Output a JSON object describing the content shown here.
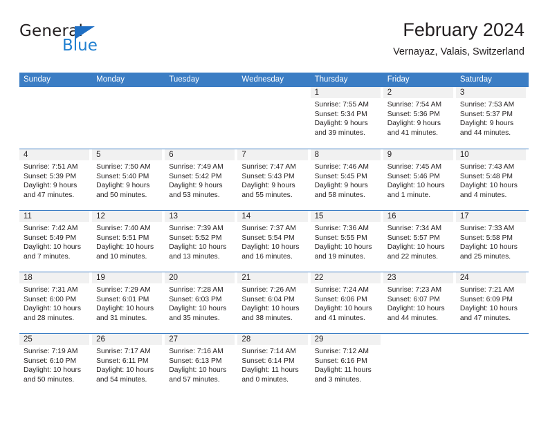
{
  "logo": {
    "word_top": "General",
    "word_bottom": "Blue",
    "triangle_color": "#1f6fc4",
    "blue_color": "#1f7fd0"
  },
  "header": {
    "title": "February 2024",
    "subtitle": "Vernayaz, Valais, Switzerland"
  },
  "theme": {
    "header_row_bg": "#3b7dc4",
    "daynum_bg": "#f1f1f1",
    "rule_color": "#3b7dc4",
    "text_color": "#231f20"
  },
  "weekdays": [
    "Sunday",
    "Monday",
    "Tuesday",
    "Wednesday",
    "Thursday",
    "Friday",
    "Saturday"
  ],
  "weeks": [
    [
      {
        "day": "",
        "blank": true
      },
      {
        "day": "",
        "blank": true
      },
      {
        "day": "",
        "blank": true
      },
      {
        "day": "",
        "blank": true
      },
      {
        "day": "1",
        "sunrise": "Sunrise: 7:55 AM",
        "sunset": "Sunset: 5:34 PM",
        "daylight1": "Daylight: 9 hours",
        "daylight2": "and 39 minutes."
      },
      {
        "day": "2",
        "sunrise": "Sunrise: 7:54 AM",
        "sunset": "Sunset: 5:36 PM",
        "daylight1": "Daylight: 9 hours",
        "daylight2": "and 41 minutes."
      },
      {
        "day": "3",
        "sunrise": "Sunrise: 7:53 AM",
        "sunset": "Sunset: 5:37 PM",
        "daylight1": "Daylight: 9 hours",
        "daylight2": "and 44 minutes."
      }
    ],
    [
      {
        "day": "4",
        "sunrise": "Sunrise: 7:51 AM",
        "sunset": "Sunset: 5:39 PM",
        "daylight1": "Daylight: 9 hours",
        "daylight2": "and 47 minutes."
      },
      {
        "day": "5",
        "sunrise": "Sunrise: 7:50 AM",
        "sunset": "Sunset: 5:40 PM",
        "daylight1": "Daylight: 9 hours",
        "daylight2": "and 50 minutes."
      },
      {
        "day": "6",
        "sunrise": "Sunrise: 7:49 AM",
        "sunset": "Sunset: 5:42 PM",
        "daylight1": "Daylight: 9 hours",
        "daylight2": "and 53 minutes."
      },
      {
        "day": "7",
        "sunrise": "Sunrise: 7:47 AM",
        "sunset": "Sunset: 5:43 PM",
        "daylight1": "Daylight: 9 hours",
        "daylight2": "and 55 minutes."
      },
      {
        "day": "8",
        "sunrise": "Sunrise: 7:46 AM",
        "sunset": "Sunset: 5:45 PM",
        "daylight1": "Daylight: 9 hours",
        "daylight2": "and 58 minutes."
      },
      {
        "day": "9",
        "sunrise": "Sunrise: 7:45 AM",
        "sunset": "Sunset: 5:46 PM",
        "daylight1": "Daylight: 10 hours",
        "daylight2": "and 1 minute."
      },
      {
        "day": "10",
        "sunrise": "Sunrise: 7:43 AM",
        "sunset": "Sunset: 5:48 PM",
        "daylight1": "Daylight: 10 hours",
        "daylight2": "and 4 minutes."
      }
    ],
    [
      {
        "day": "11",
        "sunrise": "Sunrise: 7:42 AM",
        "sunset": "Sunset: 5:49 PM",
        "daylight1": "Daylight: 10 hours",
        "daylight2": "and 7 minutes."
      },
      {
        "day": "12",
        "sunrise": "Sunrise: 7:40 AM",
        "sunset": "Sunset: 5:51 PM",
        "daylight1": "Daylight: 10 hours",
        "daylight2": "and 10 minutes."
      },
      {
        "day": "13",
        "sunrise": "Sunrise: 7:39 AM",
        "sunset": "Sunset: 5:52 PM",
        "daylight1": "Daylight: 10 hours",
        "daylight2": "and 13 minutes."
      },
      {
        "day": "14",
        "sunrise": "Sunrise: 7:37 AM",
        "sunset": "Sunset: 5:54 PM",
        "daylight1": "Daylight: 10 hours",
        "daylight2": "and 16 minutes."
      },
      {
        "day": "15",
        "sunrise": "Sunrise: 7:36 AM",
        "sunset": "Sunset: 5:55 PM",
        "daylight1": "Daylight: 10 hours",
        "daylight2": "and 19 minutes."
      },
      {
        "day": "16",
        "sunrise": "Sunrise: 7:34 AM",
        "sunset": "Sunset: 5:57 PM",
        "daylight1": "Daylight: 10 hours",
        "daylight2": "and 22 minutes."
      },
      {
        "day": "17",
        "sunrise": "Sunrise: 7:33 AM",
        "sunset": "Sunset: 5:58 PM",
        "daylight1": "Daylight: 10 hours",
        "daylight2": "and 25 minutes."
      }
    ],
    [
      {
        "day": "18",
        "sunrise": "Sunrise: 7:31 AM",
        "sunset": "Sunset: 6:00 PM",
        "daylight1": "Daylight: 10 hours",
        "daylight2": "and 28 minutes."
      },
      {
        "day": "19",
        "sunrise": "Sunrise: 7:29 AM",
        "sunset": "Sunset: 6:01 PM",
        "daylight1": "Daylight: 10 hours",
        "daylight2": "and 31 minutes."
      },
      {
        "day": "20",
        "sunrise": "Sunrise: 7:28 AM",
        "sunset": "Sunset: 6:03 PM",
        "daylight1": "Daylight: 10 hours",
        "daylight2": "and 35 minutes."
      },
      {
        "day": "21",
        "sunrise": "Sunrise: 7:26 AM",
        "sunset": "Sunset: 6:04 PM",
        "daylight1": "Daylight: 10 hours",
        "daylight2": "and 38 minutes."
      },
      {
        "day": "22",
        "sunrise": "Sunrise: 7:24 AM",
        "sunset": "Sunset: 6:06 PM",
        "daylight1": "Daylight: 10 hours",
        "daylight2": "and 41 minutes."
      },
      {
        "day": "23",
        "sunrise": "Sunrise: 7:23 AM",
        "sunset": "Sunset: 6:07 PM",
        "daylight1": "Daylight: 10 hours",
        "daylight2": "and 44 minutes."
      },
      {
        "day": "24",
        "sunrise": "Sunrise: 7:21 AM",
        "sunset": "Sunset: 6:09 PM",
        "daylight1": "Daylight: 10 hours",
        "daylight2": "and 47 minutes."
      }
    ],
    [
      {
        "day": "25",
        "sunrise": "Sunrise: 7:19 AM",
        "sunset": "Sunset: 6:10 PM",
        "daylight1": "Daylight: 10 hours",
        "daylight2": "and 50 minutes."
      },
      {
        "day": "26",
        "sunrise": "Sunrise: 7:17 AM",
        "sunset": "Sunset: 6:11 PM",
        "daylight1": "Daylight: 10 hours",
        "daylight2": "and 54 minutes."
      },
      {
        "day": "27",
        "sunrise": "Sunrise: 7:16 AM",
        "sunset": "Sunset: 6:13 PM",
        "daylight1": "Daylight: 10 hours",
        "daylight2": "and 57 minutes."
      },
      {
        "day": "28",
        "sunrise": "Sunrise: 7:14 AM",
        "sunset": "Sunset: 6:14 PM",
        "daylight1": "Daylight: 11 hours",
        "daylight2": "and 0 minutes."
      },
      {
        "day": "29",
        "sunrise": "Sunrise: 7:12 AM",
        "sunset": "Sunset: 6:16 PM",
        "daylight1": "Daylight: 11 hours",
        "daylight2": "and 3 minutes."
      },
      {
        "day": "",
        "blank": true
      },
      {
        "day": "",
        "blank": true
      }
    ]
  ]
}
